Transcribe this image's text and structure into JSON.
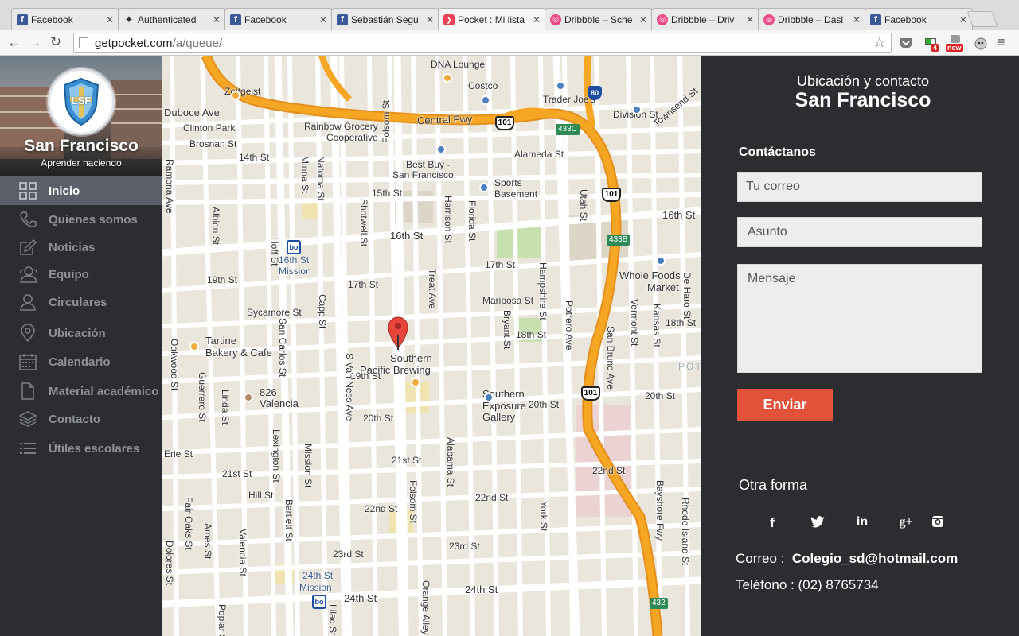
{
  "browser": {
    "tabs": [
      {
        "title": "Facebook",
        "icon": "facebook-icon",
        "active": false
      },
      {
        "title": "Authenticated",
        "icon": "bird-icon",
        "active": false
      },
      {
        "title": "Facebook",
        "icon": "facebook-icon",
        "active": false
      },
      {
        "title": "Sebastián Segu",
        "icon": "facebook-icon",
        "active": false
      },
      {
        "title": "Pocket : Mi lista",
        "icon": "pocket-icon",
        "active": true
      },
      {
        "title": "Dribbble – Sche",
        "icon": "dribbble-icon",
        "active": false
      },
      {
        "title": "Dribbble – Driv",
        "icon": "dribbble-icon",
        "active": false
      },
      {
        "title": "Dribbble – Dasl",
        "icon": "dribbble-icon",
        "active": false
      },
      {
        "title": "Facebook",
        "icon": "facebook-icon",
        "active": false
      }
    ],
    "url_host": "getpocket.com",
    "url_path": "/a/queue/",
    "extension_badge_count": "4",
    "extension_badge_new": "new"
  },
  "sidebar": {
    "school_name": "San Francisco",
    "tagline": "Aprender haciendo",
    "logo_text": "LSF",
    "items": [
      {
        "label": "Inicio",
        "icon": "grid-icon",
        "active": true
      },
      {
        "label": "Quienes somos",
        "icon": "phone-icon",
        "active": false
      },
      {
        "label": "Noticias",
        "icon": "edit-icon",
        "active": false
      },
      {
        "label": "Equipo",
        "icon": "group-icon",
        "active": false
      },
      {
        "label": "Circulares",
        "icon": "user-icon",
        "active": false
      },
      {
        "label": "Ubicación",
        "icon": "location-pin-icon",
        "active": false
      },
      {
        "label": "Calendario",
        "icon": "calendar-icon",
        "active": false
      },
      {
        "label": "Material académico",
        "icon": "document-icon",
        "active": false
      },
      {
        "label": "Contacto",
        "icon": "layers-icon",
        "active": false
      },
      {
        "label": "Útiles escolares",
        "icon": "list-icon",
        "active": false
      }
    ]
  },
  "map": {
    "labels": [
      "Zeitgeist",
      "Duboce Ave",
      "Clinton Park",
      "Brosnan St",
      "14th St",
      "15th St",
      "16th St",
      "16th St",
      "17th St",
      "17th St",
      "18th St",
      "18th St",
      "19th St",
      "19th St",
      "20th St",
      "20th St",
      "20th St",
      "21st St",
      "21st St",
      "22nd St",
      "22nd St",
      "22nd St",
      "23rd St",
      "23rd St",
      "24th St",
      "24th St",
      "Central Fwy",
      "Rainbow Grocery",
      "Cooperative",
      "Best Buy -",
      "San Francisco",
      "Sports",
      "Basement",
      "Costco",
      "Trader Joe's",
      "DNA Lounge",
      "Alameda St",
      "Division St",
      "Townsend St",
      "Whole Foods",
      "Market",
      "Mariposa St",
      "Sycamore St",
      "Tartine",
      "Bakery & Cafe",
      "826",
      "Valencia",
      "Hill St",
      "Southern",
      "Pacific Brewing",
      "Southern",
      "Exposure",
      "Gallery",
      "16th St",
      "Mission",
      "24th St",
      "Mission",
      "Valencia St",
      "Guerrero St",
      "Mission St",
      "S Van Ness Ave",
      "Folsom St",
      "Potrero Ave",
      "Bayshore Fwy",
      "Dolores St",
      "Harrison St",
      "Bryant St",
      "Florida St",
      "Alabama St",
      "York St",
      "Hampshire St",
      "Vermont St",
      "Kansas St",
      "Rhode Island St",
      "De Haro St",
      "Utah St",
      "San Bruno Ave",
      "Capp St",
      "Shotwell St",
      "Treat Ave",
      "Lexington St",
      "Bartlett St",
      "San Carlos St",
      "Hoff St",
      "Minna St",
      "Natoma St",
      "Albion St",
      "Linda St",
      "Oakwood St",
      "Ramona Ave",
      "Fair Oaks St",
      "Ames St",
      "Poplar St",
      "Lilac St",
      "Orange Alley",
      "Erie St",
      "Folsom St",
      "POT"
    ],
    "highway_labels": [
      "101",
      "101",
      "101",
      "80",
      "433C",
      "433B",
      "432"
    ]
  },
  "panel": {
    "heading": "Ubicación y contacto",
    "city": "San Francisco",
    "contact_heading": "Contáctanos",
    "email_placeholder": "Tu correo",
    "subject_placeholder": "Asunto",
    "message_placeholder": "Mensaje",
    "send_label": "Enviar",
    "other_heading": "Otra forma",
    "social": [
      {
        "label": "f",
        "icon": "facebook-icon"
      },
      {
        "label": "t",
        "icon": "twitter-icon"
      },
      {
        "label": "in",
        "icon": "linkedin-icon"
      },
      {
        "label": "g+",
        "icon": "google-plus-icon"
      },
      {
        "label": "ig",
        "icon": "instagram-icon"
      }
    ],
    "email_label": "Correo :",
    "email_value": "Colegio_sd@hotmail.com",
    "phone_label": "Teléfono :",
    "phone_value": "(02) 8765734"
  },
  "colors": {
    "sidebar_bg": "#2b2d31",
    "active_item": "#5b5f69",
    "accent_button": "#e2513a",
    "freeway": "#f5a623"
  }
}
